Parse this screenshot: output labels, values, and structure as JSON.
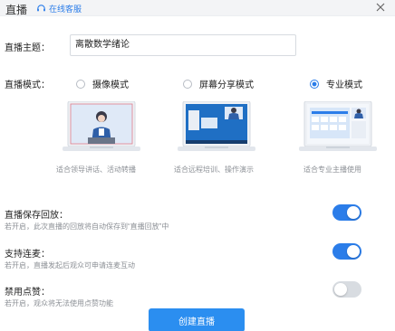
{
  "window": {
    "title": "直播",
    "service_link": "在线客服",
    "icons": {
      "service": "headset-icon",
      "close": "close-icon"
    }
  },
  "topic": {
    "label": "直播主题：",
    "value": "离散数学绪论"
  },
  "mode": {
    "label": "直播模式：",
    "selected": "professional",
    "options": [
      {
        "id": "camera",
        "label": "摄像模式",
        "caption": "适合领导讲话、活动转播",
        "checked": false
      },
      {
        "id": "screen",
        "label": "屏幕分享模式",
        "caption": "适合远程培训、操作演示",
        "checked": false
      },
      {
        "id": "professional",
        "label": "专业模式",
        "caption": "适合专业主播使用",
        "checked": true
      }
    ]
  },
  "settings": [
    {
      "id": "replay",
      "title": "直播保存回放：",
      "desc": "若开启，此次直播的回放将自动保存到“直播回放”中",
      "enabled": true
    },
    {
      "id": "mic_link",
      "title": "支持连麦：",
      "desc": "若开启，直播发起后观众可申请连麦互动",
      "enabled": true
    },
    {
      "id": "likes",
      "title": "禁用点赞：",
      "desc": "若开启，观众将无法使用点赞功能",
      "enabled": false
    }
  ],
  "create_button": "创建直播",
  "colors": {
    "accent": "#2b7de9",
    "button": "#2b8ef0",
    "toggle_off": "#d8dce1"
  }
}
